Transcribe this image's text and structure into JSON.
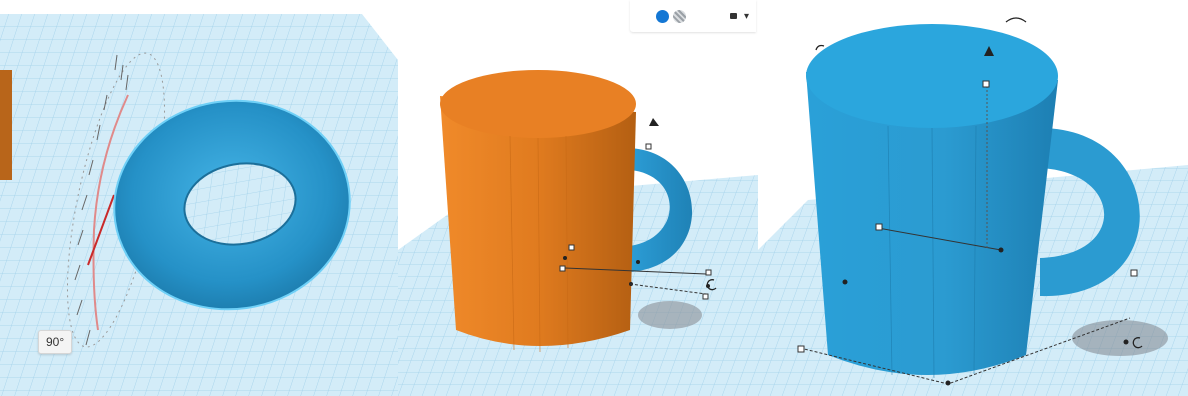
{
  "panels": [
    {
      "name": "rotate-torus-view",
      "rotation_angle_label": "90°",
      "object_color": "#2b9bd1"
    },
    {
      "name": "mug-assembly-view",
      "toolbar": {
        "solid_icon": "solid-shape-icon",
        "hole_icon": "hole-shape-icon",
        "lock_icon": "lock-icon",
        "light_icon": "light-bulb-icon"
      },
      "cylinder_color": "#e07b1f",
      "handle_color": "#2b9bd1"
    },
    {
      "name": "mug-complete-view",
      "object_color": "#2b9bd1"
    }
  ],
  "colors": {
    "workplane_blue": "#cfe9f6",
    "grid_line": "#9fd0ea",
    "shape_blue": "#2b9bd1",
    "shape_orange": "#e07b1f"
  }
}
